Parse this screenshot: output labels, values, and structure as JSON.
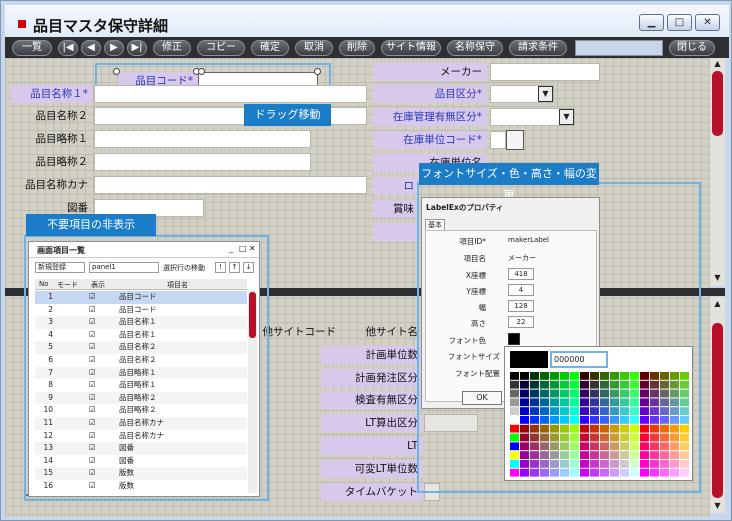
{
  "window": {
    "title": "品目マスタ保守詳細",
    "buttons": [
      "▁",
      "□",
      "✕"
    ]
  },
  "toolbar": {
    "list": "一覧",
    "nav": [
      "|◀",
      "◀",
      "▶",
      "▶|"
    ],
    "edit": "修正",
    "copy": "コピー",
    "confirm": "確定",
    "cancel": "取消",
    "delete": "削除",
    "site_info": "サイト情報",
    "name_maint": "名称保守",
    "billing": "請求条件",
    "close": "閉じる"
  },
  "form": {
    "hinmoku_code": "品目コード*",
    "name1": "品目名称１*",
    "name2": "品目名称２",
    "short1": "品目略称１",
    "short2": "品目略称２",
    "kana": "品目名称カナ",
    "zuban": "図番",
    "maker": "メーカー",
    "category": "品目区分*",
    "stock_managed": "在庫管理有無区分*",
    "stock_unit": "在庫単位コード*",
    "partial_1": "在庫単位名",
    "partial_2": "ロ",
    "partial_3": "賞味",
    "other_site_code": "他サイトコード",
    "other_site_name": "他サイト名",
    "plan_unit": "計画単位数",
    "plan_order": "計画発注区分",
    "inspect": "検査有無区分",
    "lt_calc": "LT算出区分",
    "lt": "LT",
    "var_lt": "可変LT単位数",
    "time_bucket": "タイムバケット",
    "partial_bottom": "入"
  },
  "callouts": {
    "drag": "ドラッグ移動",
    "hide": "不要項目の非表示",
    "font": "フォントサイズ・色・高さ・幅の変更"
  },
  "list_dialog": {
    "title": "画面項目一覧",
    "title_buttons": [
      "_",
      "□",
      "✕"
    ],
    "select_value": "新規登録",
    "panel_value": "panel1",
    "move_label": "選択行の移動",
    "move_buttons": [
      "!",
      "↑",
      "↓"
    ],
    "headers": [
      "No",
      "モード",
      "表示",
      "項目名"
    ],
    "rows": [
      {
        "no": "1",
        "name": "品目コード",
        "checked": "☑"
      },
      {
        "no": "2",
        "name": "品目コード",
        "checked": "☑"
      },
      {
        "no": "3",
        "name": "品目名称１",
        "checked": "☑"
      },
      {
        "no": "4",
        "name": "品目名称１",
        "checked": "☑"
      },
      {
        "no": "5",
        "name": "品目名称２",
        "checked": "☑"
      },
      {
        "no": "6",
        "name": "品目名称２",
        "checked": "☑"
      },
      {
        "no": "7",
        "name": "品目略称１",
        "checked": "☑"
      },
      {
        "no": "8",
        "name": "品目略称１",
        "checked": "☑"
      },
      {
        "no": "9",
        "name": "品目略称２",
        "checked": "☑"
      },
      {
        "no": "10",
        "name": "品目略称２",
        "checked": "☑"
      },
      {
        "no": "11",
        "name": "品目名称カナ",
        "checked": "☑"
      },
      {
        "no": "12",
        "name": "品目名称カナ",
        "checked": "☑"
      },
      {
        "no": "13",
        "name": "図番",
        "checked": "☑"
      },
      {
        "no": "14",
        "name": "図番",
        "checked": "☑"
      },
      {
        "no": "15",
        "name": "版数",
        "checked": "☑"
      },
      {
        "no": "16",
        "name": "版数",
        "checked": "☑"
      }
    ]
  },
  "props_dialog": {
    "title": "LabelExのプロパティ",
    "tab": "基本",
    "id_label": "項目ID*",
    "id_value": "makerLabel",
    "name_label": "項目名",
    "name_value": "メーカー",
    "x_label": "X座標",
    "x_value": "418",
    "y_label": "Y座標",
    "y_value": "4",
    "w_label": "幅",
    "w_value": "128",
    "h_label": "高さ",
    "h_value": "22",
    "fontcolor_label": "フォント色",
    "fontsize_label": "フォントサイズ",
    "align_label": "フォント配置",
    "ok": "OK"
  },
  "palette": {
    "hex_value": "000000"
  },
  "colors": {
    "accent": "#1b7dc8",
    "label_bg": "#d8c9ec",
    "label_text_blue": "#2838b8",
    "toolbar_bg": "#2d2f33"
  }
}
